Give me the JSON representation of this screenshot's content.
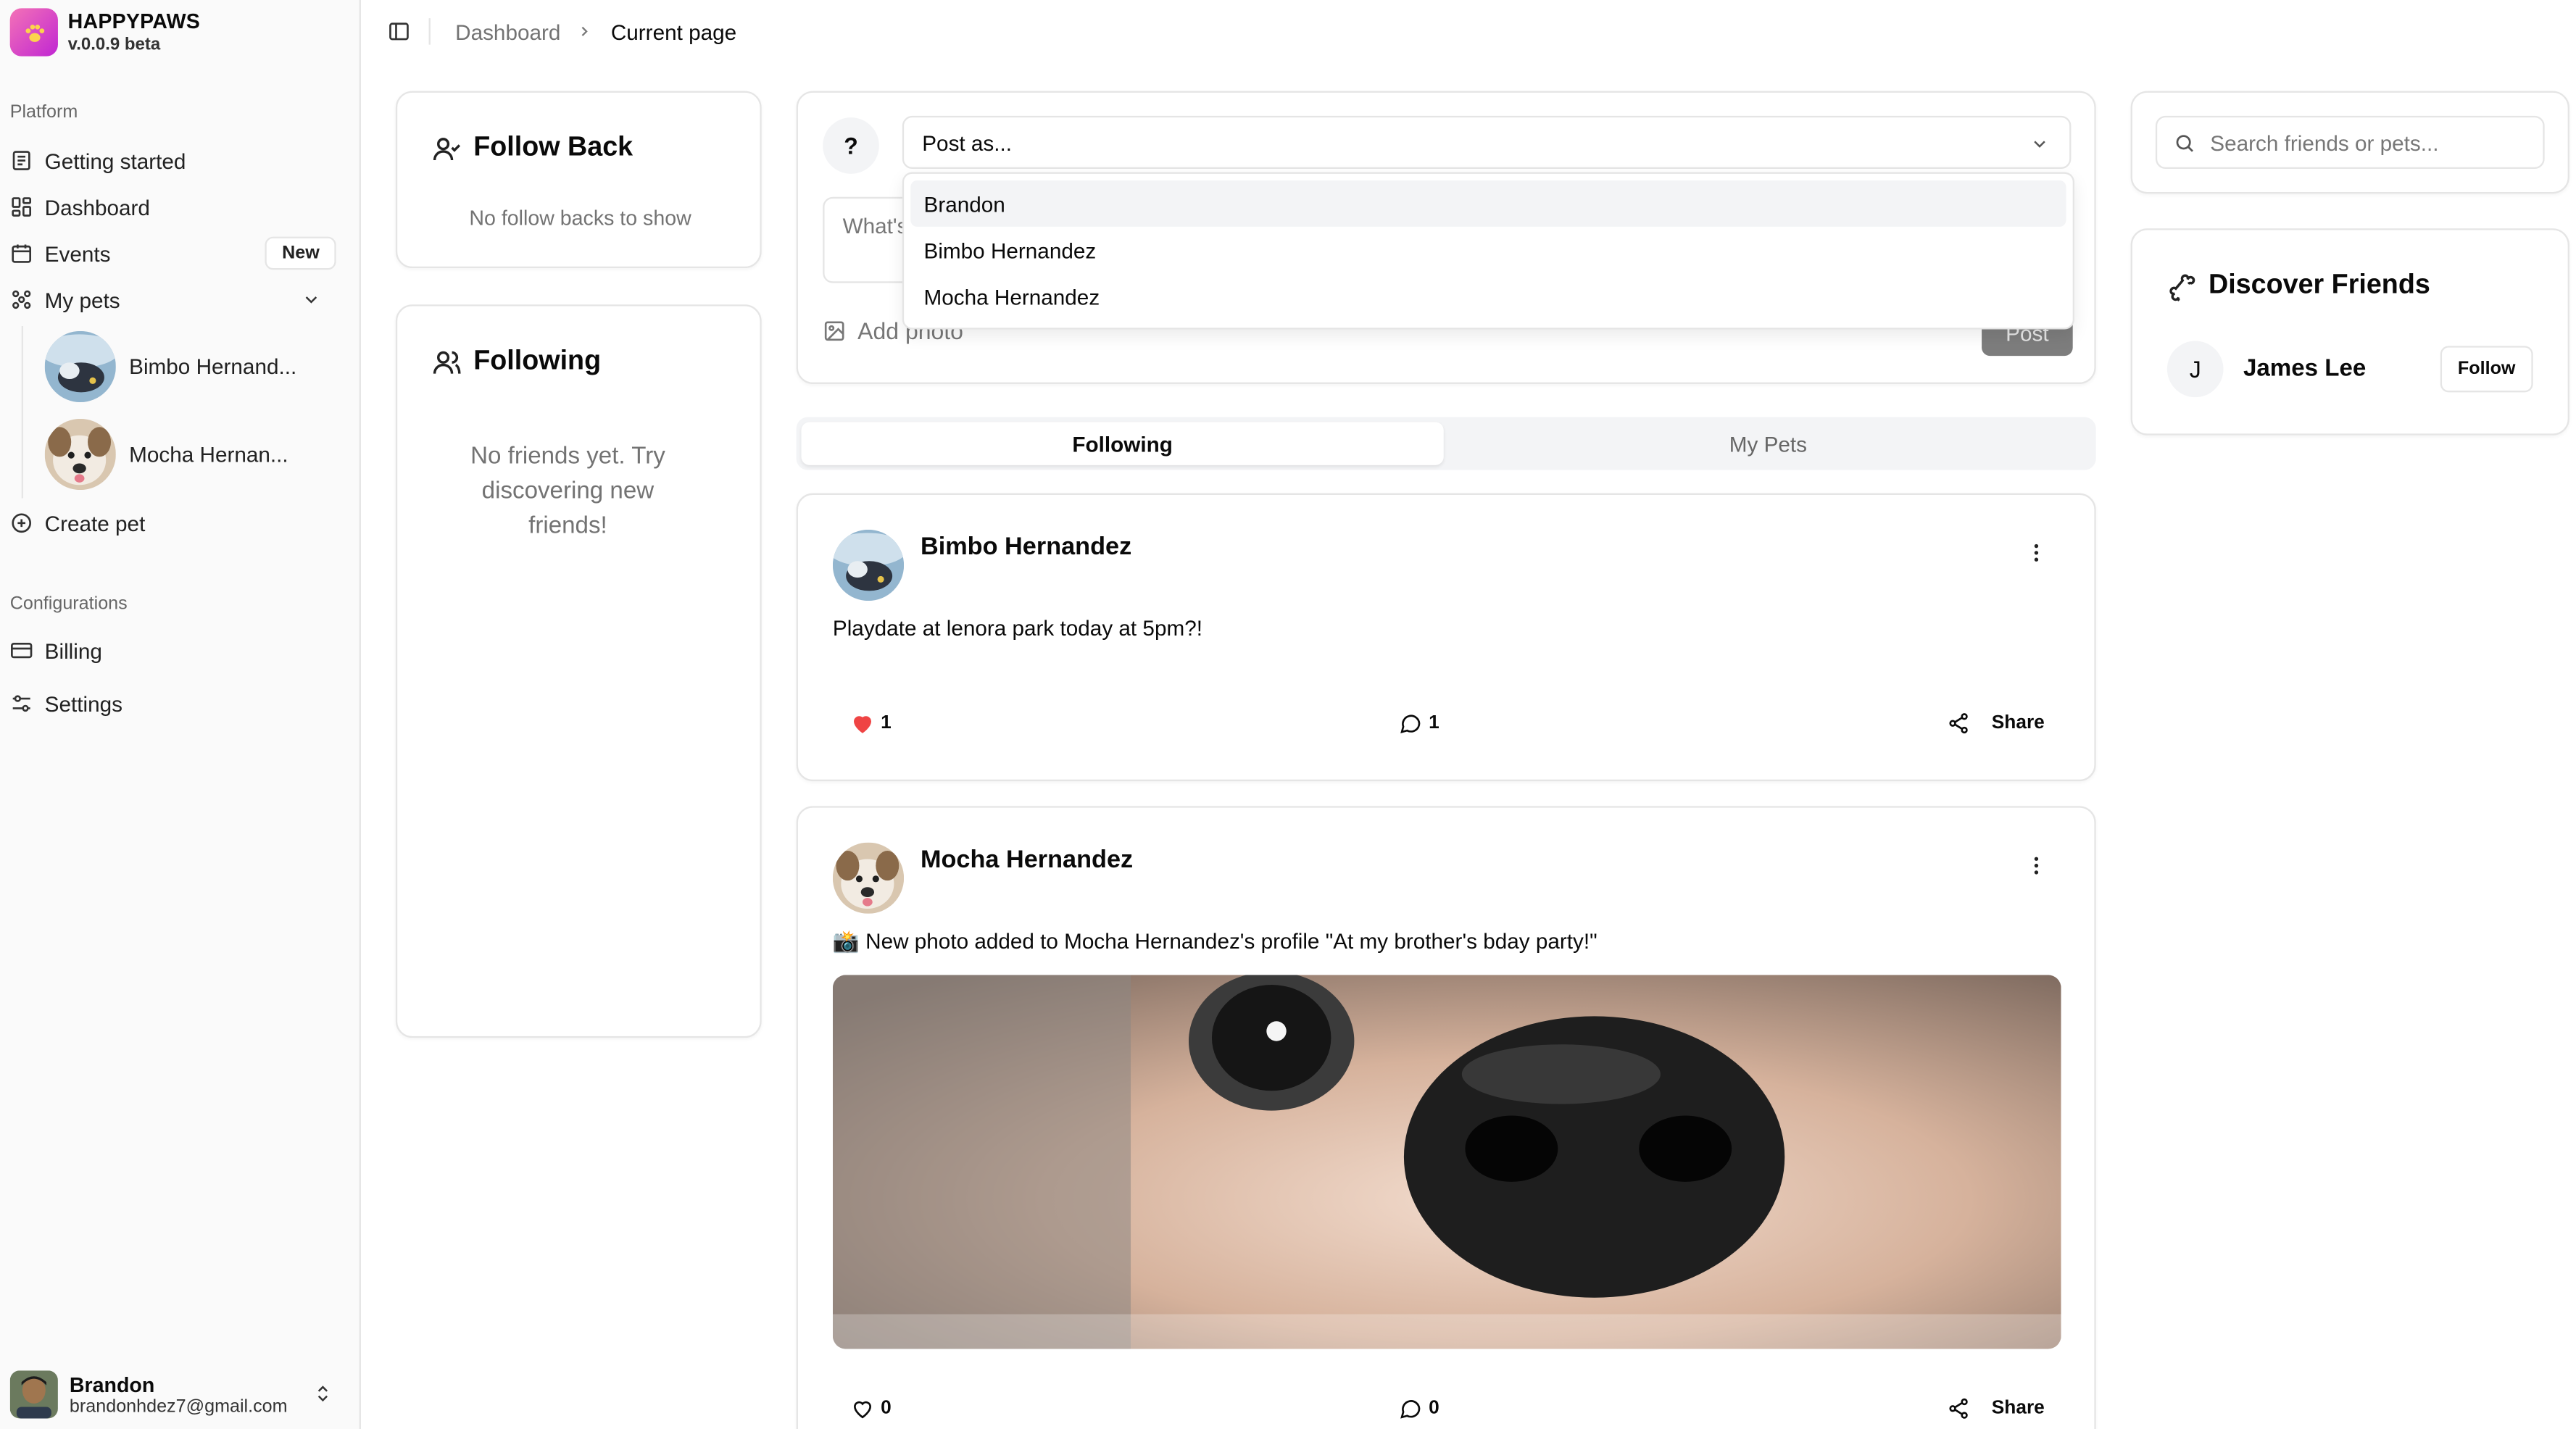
{
  "brand": {
    "name": "HAPPYPAWS",
    "version": "v.0.0.9 beta"
  },
  "sidebar": {
    "platform_label": "Platform",
    "items": [
      {
        "label": "Getting started",
        "icon": "book-icon"
      },
      {
        "label": "Dashboard",
        "icon": "grid-icon"
      },
      {
        "label": "Events",
        "icon": "calendar-icon",
        "badge": "New"
      },
      {
        "label": "My pets",
        "icon": "paw-icon"
      }
    ],
    "pets": [
      {
        "name": "Bimbo Hernand..."
      },
      {
        "name": "Mocha Hernan..."
      }
    ],
    "create_pet": "Create pet",
    "config_label": "Configurations",
    "config_items": [
      {
        "label": "Billing",
        "icon": "credit-card-icon"
      },
      {
        "label": "Settings",
        "icon": "sliders-icon"
      }
    ],
    "user": {
      "name": "Brandon",
      "email": "brandonhdez7@gmail.com"
    }
  },
  "header": {
    "breadcrumb_parent": "Dashboard",
    "breadcrumb_current": "Current page"
  },
  "follow_back": {
    "title": "Follow Back",
    "empty": "No follow backs to show"
  },
  "following_card": {
    "title": "Following",
    "empty": "No friends yet. Try discovering new friends!"
  },
  "composer": {
    "help": "?",
    "post_as_placeholder": "Post as...",
    "textarea_placeholder": "What's",
    "add_photo": "Add photo",
    "post_button": "Post",
    "options": [
      "Brandon",
      "Bimbo Hernandez",
      "Mocha Hernandez"
    ]
  },
  "tabs": [
    "Following",
    "My Pets"
  ],
  "posts": [
    {
      "author": "Bimbo Hernandez",
      "text": "Playdate at lenora park today at 5pm?!",
      "likes": "1",
      "comments": "1",
      "share": "Share",
      "liked": true
    },
    {
      "author": "Mocha Hernandez",
      "text": "📸 New photo added to Mocha Hernandez's profile \"At my brother's bday party!\"",
      "likes": "0",
      "comments": "0",
      "share": "Share",
      "liked": false
    }
  ],
  "right": {
    "search_placeholder": "Search friends or pets...",
    "discover_title": "Discover Friends",
    "friend": {
      "initial": "J",
      "name": "James Lee",
      "button": "Follow"
    }
  },
  "colors": {
    "like": "#ef4444",
    "brand_gradient": [
      "#f472b6",
      "#c026d3"
    ],
    "post_button": "#7d7d7d"
  }
}
